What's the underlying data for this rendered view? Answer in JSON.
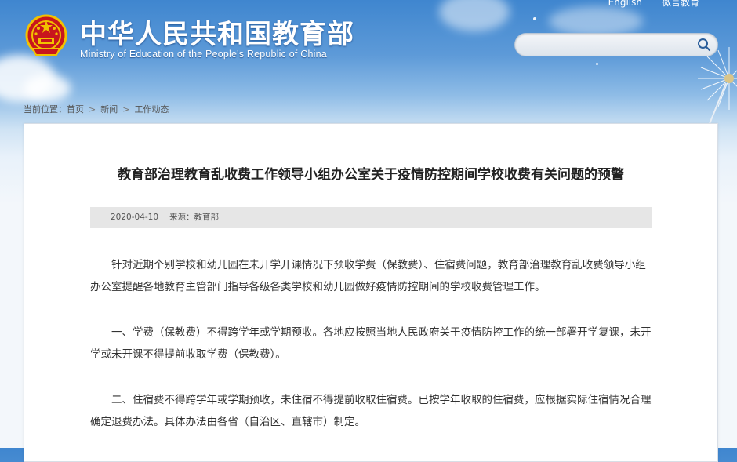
{
  "header": {
    "title": "中华人民共和国教育部",
    "subtitle": "Ministry of Education of the People's Republic of China",
    "links": [
      "English",
      "微言教育"
    ]
  },
  "search": {
    "placeholder": ""
  },
  "breadcrumb": {
    "prefix": "当前位置：",
    "items": [
      "首页",
      "新闻",
      "工作动态"
    ]
  },
  "article": {
    "title": "教育部治理教育乱收费工作领导小组办公室关于疫情防控期间学校收费有关问题的预警",
    "date": "2020-04-10",
    "source": "来源：教育部",
    "paragraphs": [
      "针对近期个别学校和幼儿园在未开学开课情况下预收学费（保教费）、住宿费问题，教育部治理教育乱收费领导小组办公室提醒各地教育主管部门指导各级各类学校和幼儿园做好疫情防控期间的学校收费管理工作。",
      "一、学费（保教费）不得跨学年或学期预收。各地应按照当地人民政府关于疫情防控工作的统一部署开学复课，未开学或未开课不得提前收取学费（保教费）。",
      "二、住宿费不得跨学年或学期预收，未住宿不得提前收取住宿费。已按学年收取的住宿费，应根据实际住宿情况合理确定退费办法。具体办法由各省（自治区、直辖市）制定。"
    ]
  },
  "colors": {
    "accent": "#3f86cf",
    "emblem_red": "#c8161d",
    "emblem_gold": "#f2c200"
  },
  "icons": [
    "national-emblem-icon",
    "search-icon"
  ]
}
